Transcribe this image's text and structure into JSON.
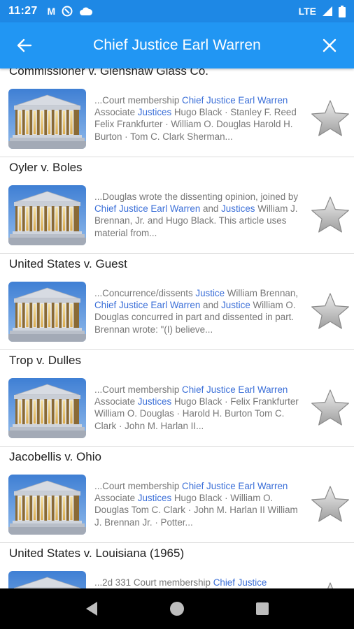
{
  "status": {
    "time": "11:27",
    "network": "LTE"
  },
  "header": {
    "title": "Chief Justice Earl Warren"
  },
  "colors": {
    "accent": "#2196f3",
    "status_bar": "#1e88e5",
    "highlight": "#3b6fd8"
  },
  "top_partial_title": "Commissioner v. Glenshaw Glass Co.",
  "results": [
    {
      "snippet": [
        {
          "t": "...Court membership "
        },
        {
          "t": "Chief Justice Earl Warren",
          "h": true
        },
        {
          "t": " Associate "
        },
        {
          "t": "Justices",
          "h": true
        },
        {
          "t": " Hugo Black · Stanley F. Reed Felix Frankfurter · William O. Douglas Harold H. Burton · Tom C. Clark Sherman..."
        }
      ]
    },
    {
      "title": "Oyler v. Boles",
      "snippet": [
        {
          "t": "...Douglas wrote the dissenting opinion, joined by "
        },
        {
          "t": "Chief Justice Earl Warren",
          "h": true
        },
        {
          "t": " and "
        },
        {
          "t": "Justices",
          "h": true
        },
        {
          "t": " William J. Brennan, Jr. and Hugo Black. This article uses material from..."
        }
      ]
    },
    {
      "title": "United States v. Guest",
      "snippet": [
        {
          "t": "...Concurrence/dissents "
        },
        {
          "t": "Justice",
          "h": true
        },
        {
          "t": " William Brennan, "
        },
        {
          "t": "Chief Justice Earl Warren",
          "h": true
        },
        {
          "t": " and "
        },
        {
          "t": "Justice",
          "h": true
        },
        {
          "t": " William O. Douglas concurred in part and dissented in part. Brennan wrote: \"(I) believe..."
        }
      ]
    },
    {
      "title": "Trop v. Dulles",
      "snippet": [
        {
          "t": "...Court membership "
        },
        {
          "t": "Chief Justice Earl Warren",
          "h": true
        },
        {
          "t": " Associate "
        },
        {
          "t": "Justices",
          "h": true
        },
        {
          "t": " Hugo Black · Felix Frankfurter William O. Douglas · Harold H. Burton Tom C. Clark · John M. Harlan II..."
        }
      ]
    },
    {
      "title": "Jacobellis v. Ohio",
      "snippet": [
        {
          "t": "...Court membership "
        },
        {
          "t": "Chief Justice Earl Warren",
          "h": true
        },
        {
          "t": " Associate "
        },
        {
          "t": "Justices",
          "h": true
        },
        {
          "t": " Hugo Black · William O. Douglas Tom C. Clark · John M. Harlan II William J. Brennan Jr. · Potter..."
        }
      ]
    },
    {
      "title": "United States v. Louisiana (1965)",
      "snippet": [
        {
          "t": "...2d 331 Court membership "
        },
        {
          "t": "Chief Justice",
          "h": true
        }
      ]
    }
  ]
}
